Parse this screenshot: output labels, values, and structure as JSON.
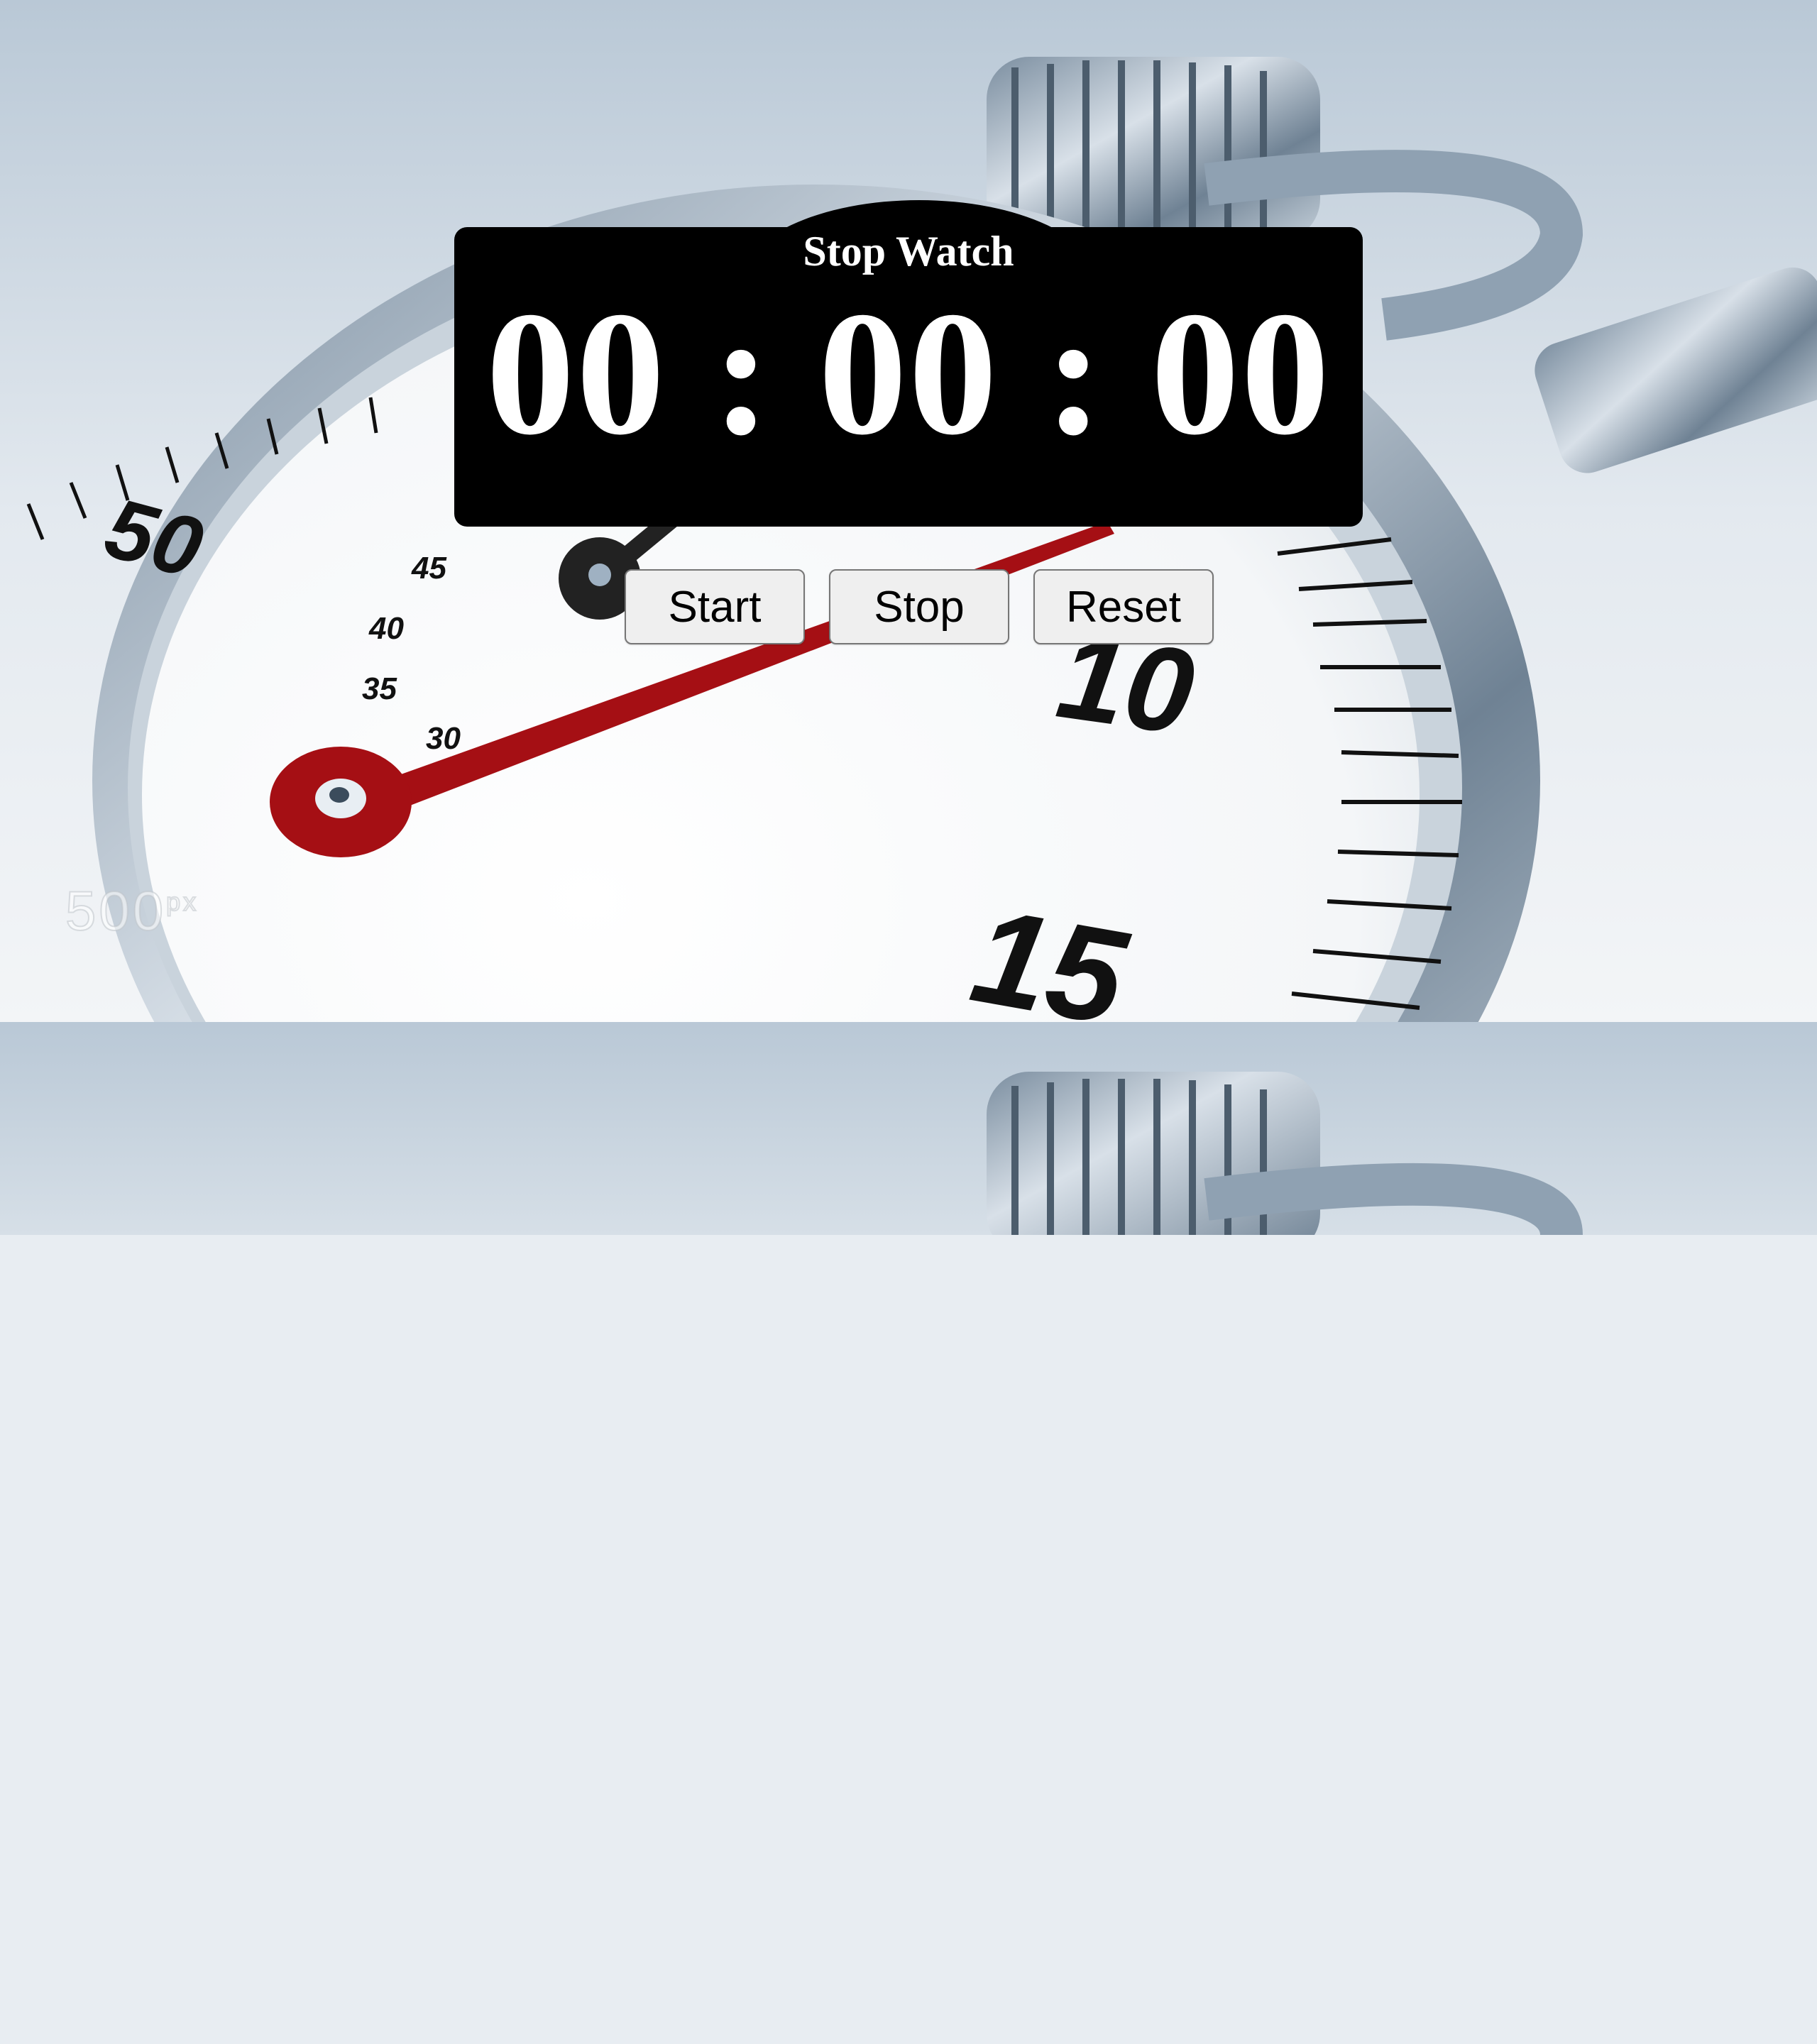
{
  "title": "Stop Watch",
  "time": {
    "hours": "00",
    "minutes": "00",
    "seconds": "00",
    "separator": ":"
  },
  "buttons": {
    "start": "Start",
    "stop": "Stop",
    "reset": "Reset"
  },
  "background": {
    "dial_numbers": [
      "50",
      "45",
      "40",
      "35",
      "30",
      "10",
      "15"
    ],
    "watermark": "500",
    "watermark_sup": "px"
  },
  "colors": {
    "panel": "#000000",
    "text": "#ffffff",
    "hand": "#a50f14",
    "button_bg": "#efefef"
  }
}
